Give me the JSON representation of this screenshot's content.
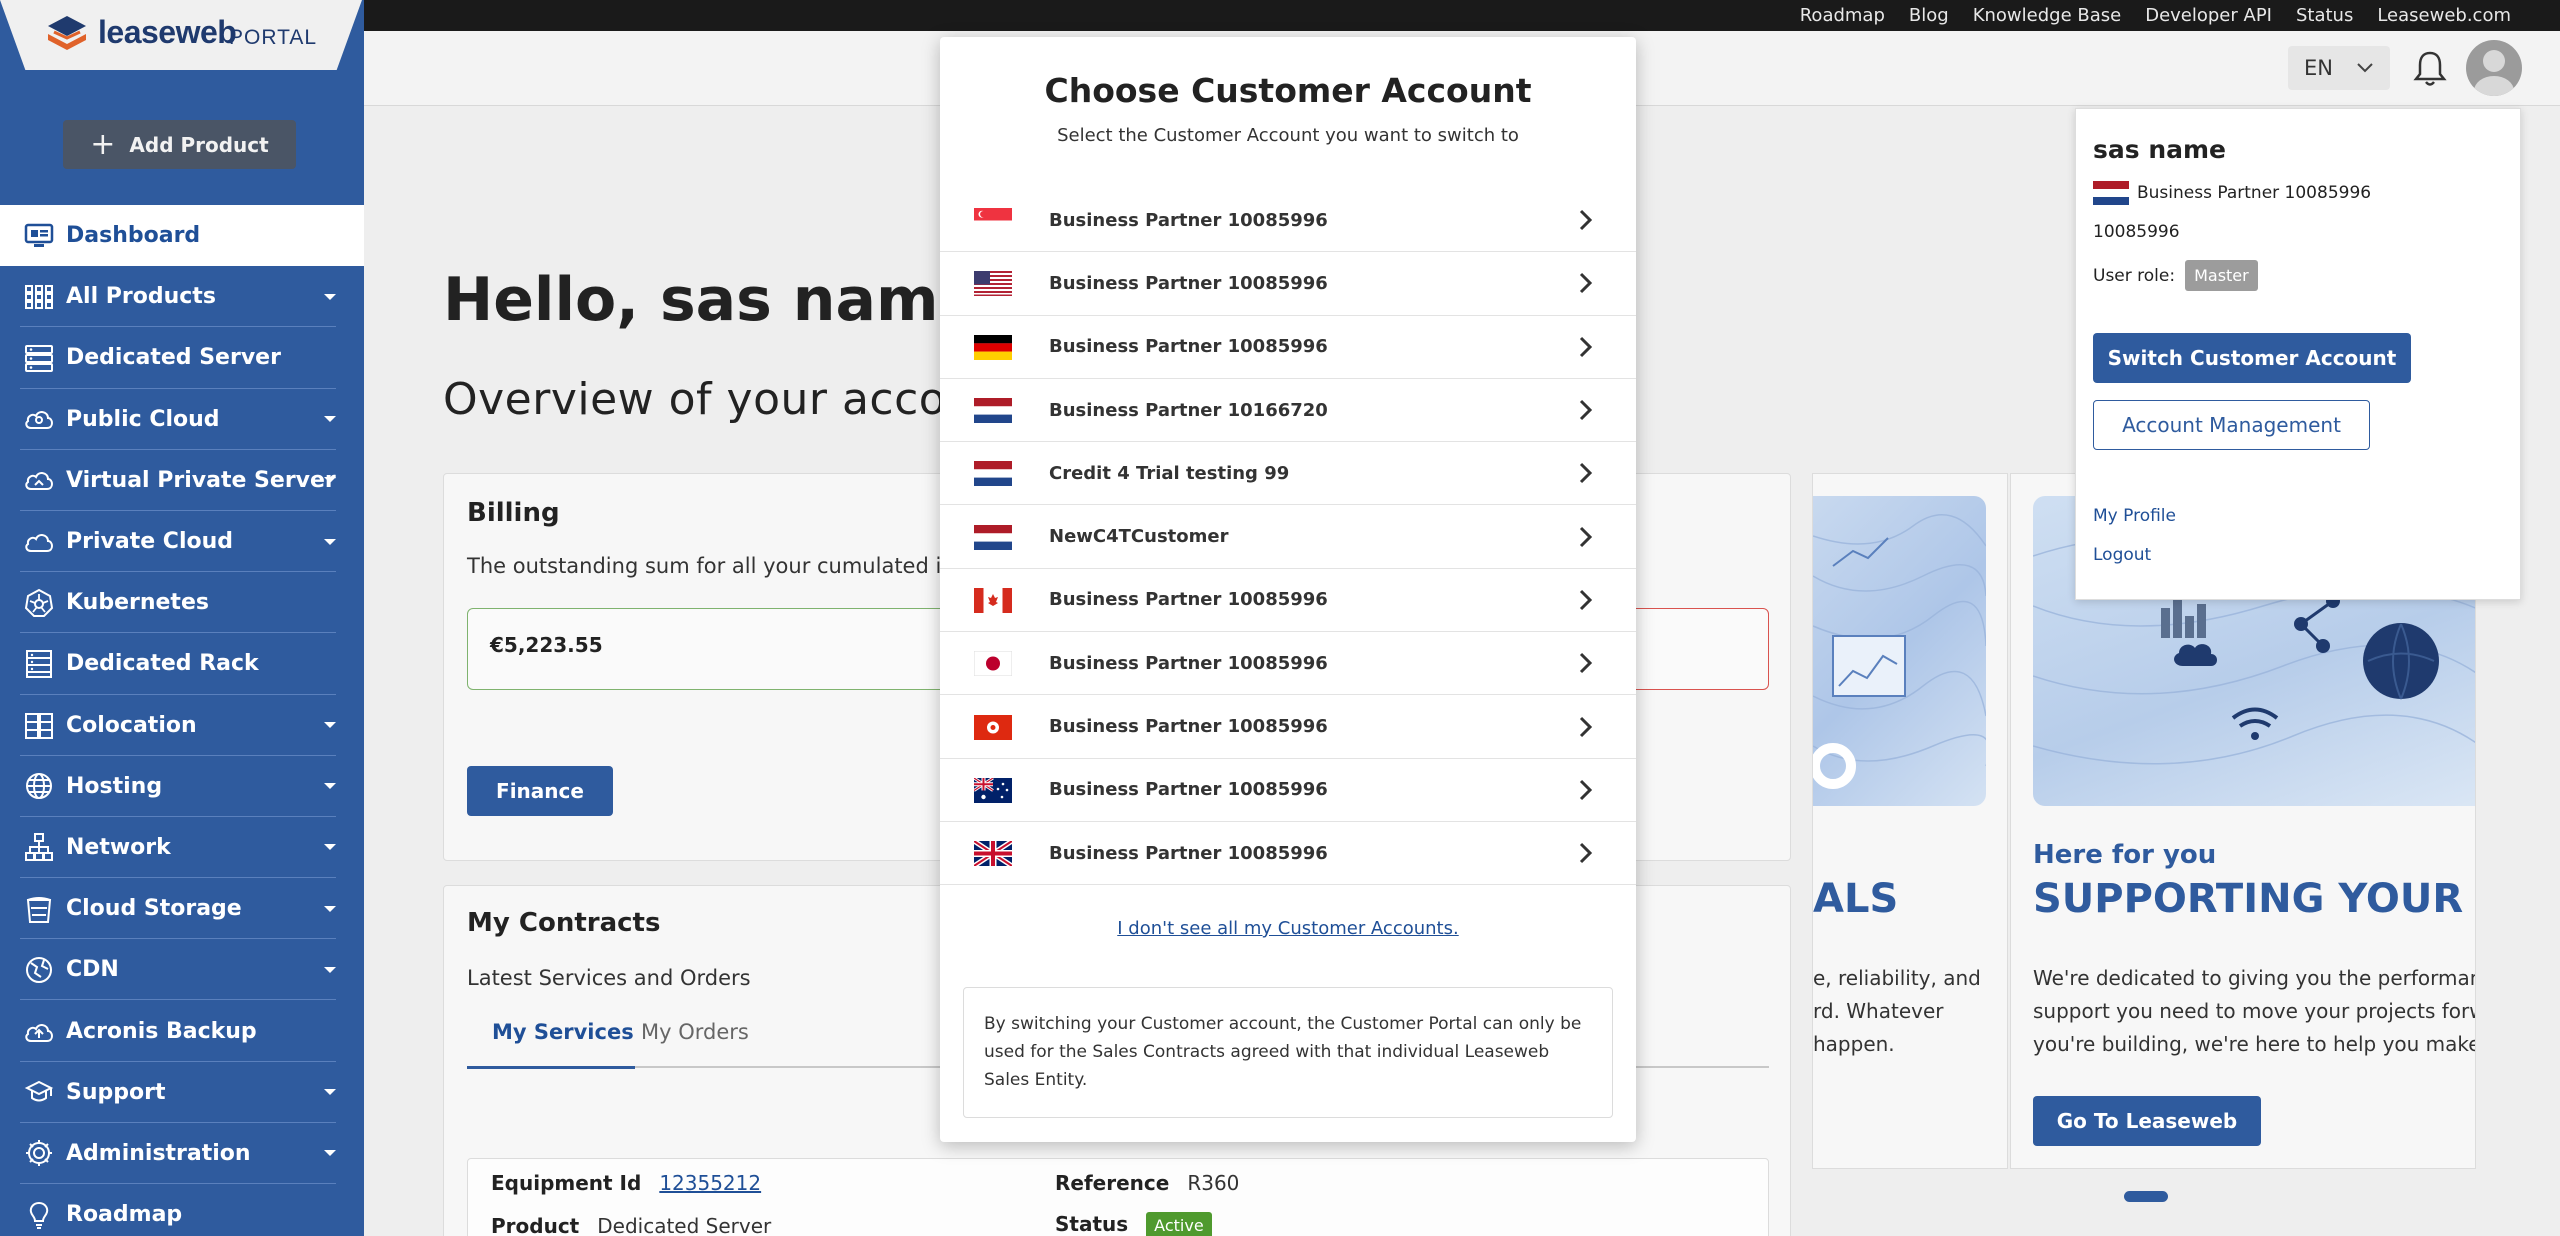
{
  "topbar": {
    "links": [
      "Roadmap",
      "Blog",
      "Knowledge Base",
      "Developer API",
      "Status",
      "Leaseweb.com"
    ]
  },
  "brand": {
    "name": "leaseweb",
    "product": "PORTAL"
  },
  "header": {
    "language": "EN"
  },
  "sidebar": {
    "add_product": "Add Product",
    "items": [
      {
        "label": "Dashboard",
        "icon": "dashboard-icon",
        "active": true,
        "expandable": false
      },
      {
        "label": "All Products",
        "icon": "grid-icon",
        "expandable": true
      },
      {
        "label": "Dedicated Server",
        "icon": "server-icon",
        "expandable": false
      },
      {
        "label": "Public Cloud",
        "icon": "cloud-person-icon",
        "expandable": true
      },
      {
        "label": "Virtual Private Server",
        "icon": "cloud-icon",
        "expandable": true
      },
      {
        "label": "Private Cloud",
        "icon": "private-cloud-icon",
        "expandable": true
      },
      {
        "label": "Kubernetes",
        "icon": "kubernetes-icon",
        "expandable": false
      },
      {
        "label": "Dedicated Rack",
        "icon": "rack-icon",
        "expandable": false
      },
      {
        "label": "Colocation",
        "icon": "colocation-icon",
        "expandable": true
      },
      {
        "label": "Hosting",
        "icon": "globe-icon",
        "expandable": true
      },
      {
        "label": "Network",
        "icon": "network-icon",
        "expandable": true
      },
      {
        "label": "Cloud Storage",
        "icon": "storage-icon",
        "expandable": true
      },
      {
        "label": "CDN",
        "icon": "cdn-icon",
        "expandable": true
      },
      {
        "label": "Acronis Backup",
        "icon": "backup-icon",
        "expandable": false
      },
      {
        "label": "Support",
        "icon": "support-icon",
        "expandable": true
      },
      {
        "label": "Administration",
        "icon": "gear-icon",
        "expandable": true
      },
      {
        "label": "Roadmap",
        "icon": "lightbulb-icon",
        "expandable": false
      }
    ]
  },
  "main": {
    "greeting": "Hello, sas name",
    "overview": "Overview of your account",
    "billing": {
      "title": "Billing",
      "description": "The outstanding sum for all your cumulated invoi",
      "amount": "€5,223.55",
      "finance_button": "Finance"
    },
    "contracts": {
      "title": "My Contracts",
      "description": "Latest Services and Orders",
      "tabs": [
        "My Services",
        "My Orders"
      ],
      "equipment_id_label": "Equipment Id",
      "equipment_id": "12355212",
      "reference_label": "Reference",
      "reference": "R360",
      "product_label": "Product",
      "product": "Dedicated Server",
      "status_label": "Status",
      "status": "Active"
    }
  },
  "promo_left": {
    "heading": "ALS",
    "text_lines": [
      "e, reliability, and",
      "rd. Whatever",
      "happen."
    ]
  },
  "promo_right": {
    "subtitle": "Here for you",
    "heading": "SUPPORTING YOUR GO",
    "text_lines": [
      "We're dedicated to giving you the performance",
      "support you need to move your projects forwa",
      "you're building, we're here to help you make it"
    ],
    "button": "Go To Leaseweb"
  },
  "account_popover": {
    "name": "sas name",
    "partner": "Business Partner 10085996",
    "number": "10085996",
    "role_label": "User role:",
    "role": "Master",
    "switch_button": "Switch Customer Account",
    "management_button": "Account Management",
    "profile_link": "My Profile",
    "logout_link": "Logout"
  },
  "modal": {
    "title": "Choose Customer Account",
    "subtitle": "Select the Customer Account you want to switch to",
    "accounts": [
      {
        "label": "Business Partner 10085996",
        "flag": "SG"
      },
      {
        "label": "Business Partner 10085996",
        "flag": "US"
      },
      {
        "label": "Business Partner 10085996",
        "flag": "DE"
      },
      {
        "label": "Business Partner 10166720",
        "flag": "NL"
      },
      {
        "label": "Credit 4 Trial testing 99",
        "flag": "NL"
      },
      {
        "label": "NewC4TCustomer",
        "flag": "NL"
      },
      {
        "label": "Business Partner 10085996",
        "flag": "CA"
      },
      {
        "label": "Business Partner 10085996",
        "flag": "JP"
      },
      {
        "label": "Business Partner 10085996",
        "flag": "HK"
      },
      {
        "label": "Business Partner 10085996",
        "flag": "AU"
      },
      {
        "label": "Business Partner 10085996",
        "flag": "UK"
      }
    ],
    "not_see_link": "I don't see all my Customer Accounts.",
    "notice": "By switching your Customer account, the Customer Portal can only be used for the Sales Contracts agreed with that individual Leaseweb Sales Entity."
  },
  "colors": {
    "primary": "#2f5b9e",
    "sidebar": "#2f5b9e",
    "topbar": "#1a1a1a",
    "success": "#4f9a2e"
  }
}
